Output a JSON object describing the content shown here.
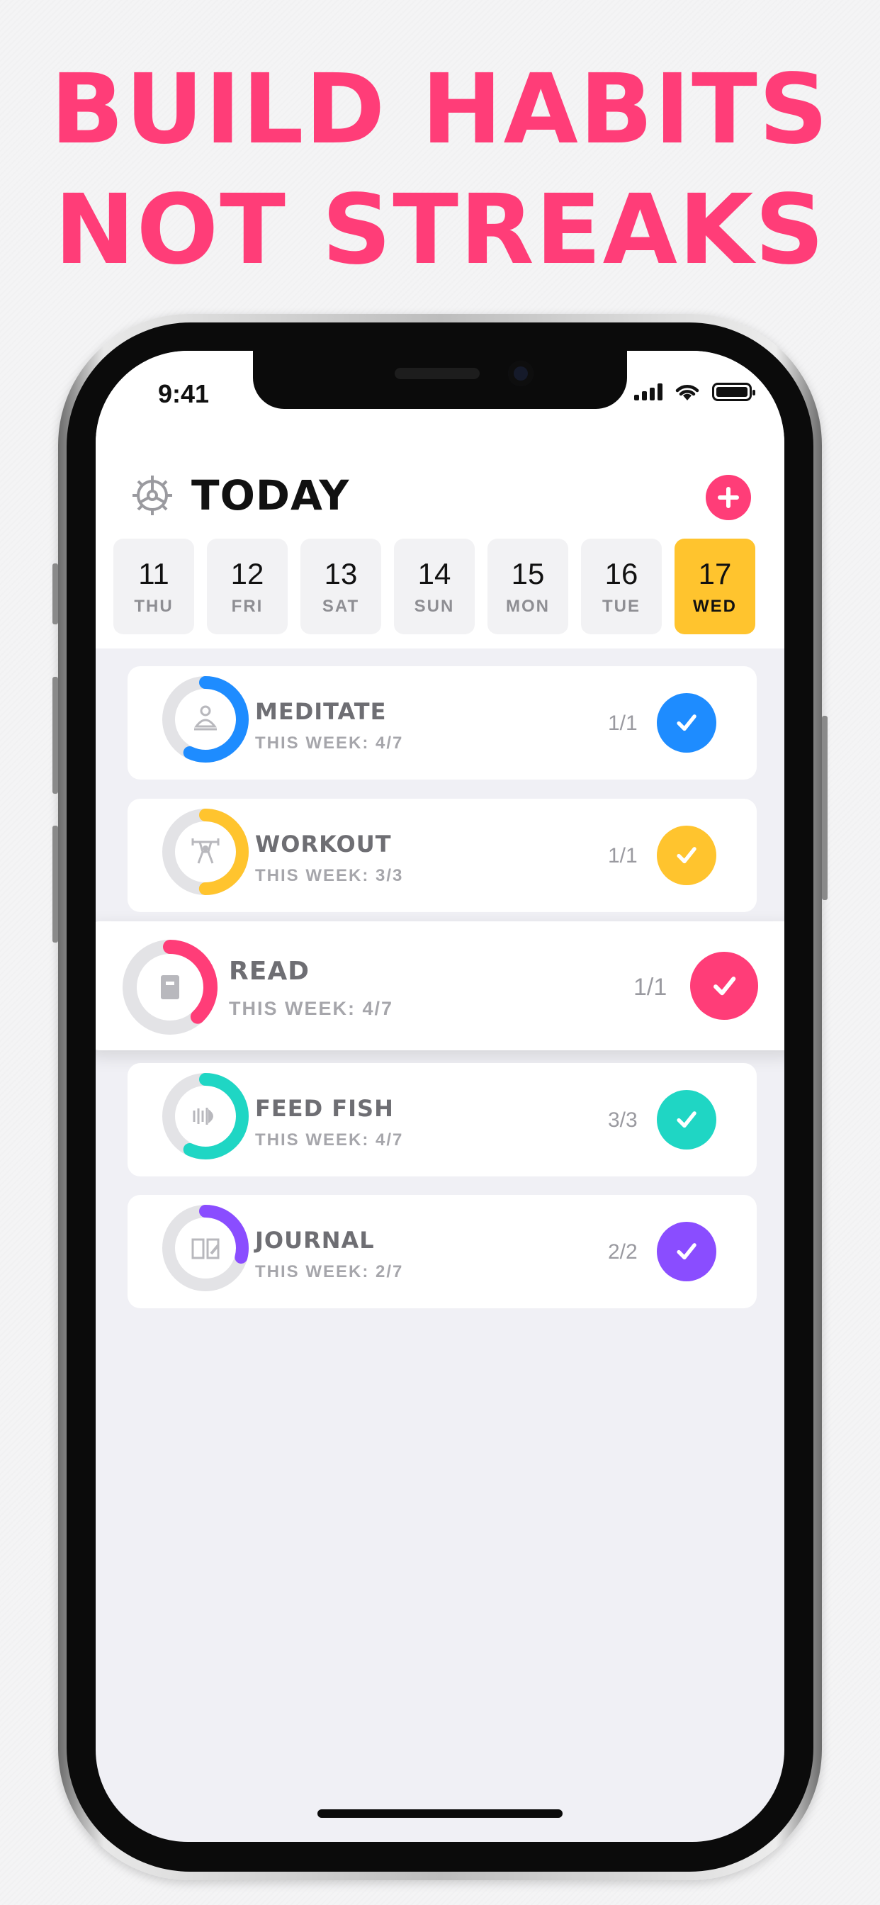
{
  "headline": {
    "line1": "BUILD HABITS",
    "line2": "NOT STREAKS"
  },
  "status_bar": {
    "time": "9:41"
  },
  "header": {
    "title": "TODAY",
    "settings_icon": "gear-icon",
    "add_icon": "plus-icon"
  },
  "days": [
    {
      "num": "11",
      "dow": "THU",
      "active": false
    },
    {
      "num": "12",
      "dow": "FRI",
      "active": false
    },
    {
      "num": "13",
      "dow": "SAT",
      "active": false
    },
    {
      "num": "14",
      "dow": "SUN",
      "active": false
    },
    {
      "num": "15",
      "dow": "MON",
      "active": false
    },
    {
      "num": "16",
      "dow": "TUE",
      "active": false
    },
    {
      "num": "17",
      "dow": "WED",
      "active": true
    }
  ],
  "habits": [
    {
      "name": "MEDITATE",
      "week": "THIS WEEK: 4/7",
      "count": "1/1",
      "color": "#1e8cff",
      "progress": 0.57,
      "icon": "meditation-icon"
    },
    {
      "name": "WORKOUT",
      "week": "THIS WEEK: 3/3",
      "count": "1/1",
      "color": "#ffc42e",
      "progress": 0.5,
      "icon": "weightlifting-icon"
    },
    {
      "name": "READ",
      "week": "THIS WEEK: 4/7",
      "count": "1/1",
      "color": "#ff3d78",
      "progress": 0.38,
      "icon": "book-icon"
    },
    {
      "name": "FEED FISH",
      "week": "THIS WEEK: 4/7",
      "count": "3/3",
      "color": "#1fd6c4",
      "progress": 0.57,
      "icon": "fish-icon"
    },
    {
      "name": "JOURNAL",
      "week": "THIS WEEK: 2/7",
      "count": "2/2",
      "color": "#8a4dff",
      "progress": 0.29,
      "icon": "journal-icon"
    }
  ],
  "colors": {
    "accent": "#ff3d78",
    "active_day": "#ffc42e",
    "background": "#f0f0f5"
  }
}
